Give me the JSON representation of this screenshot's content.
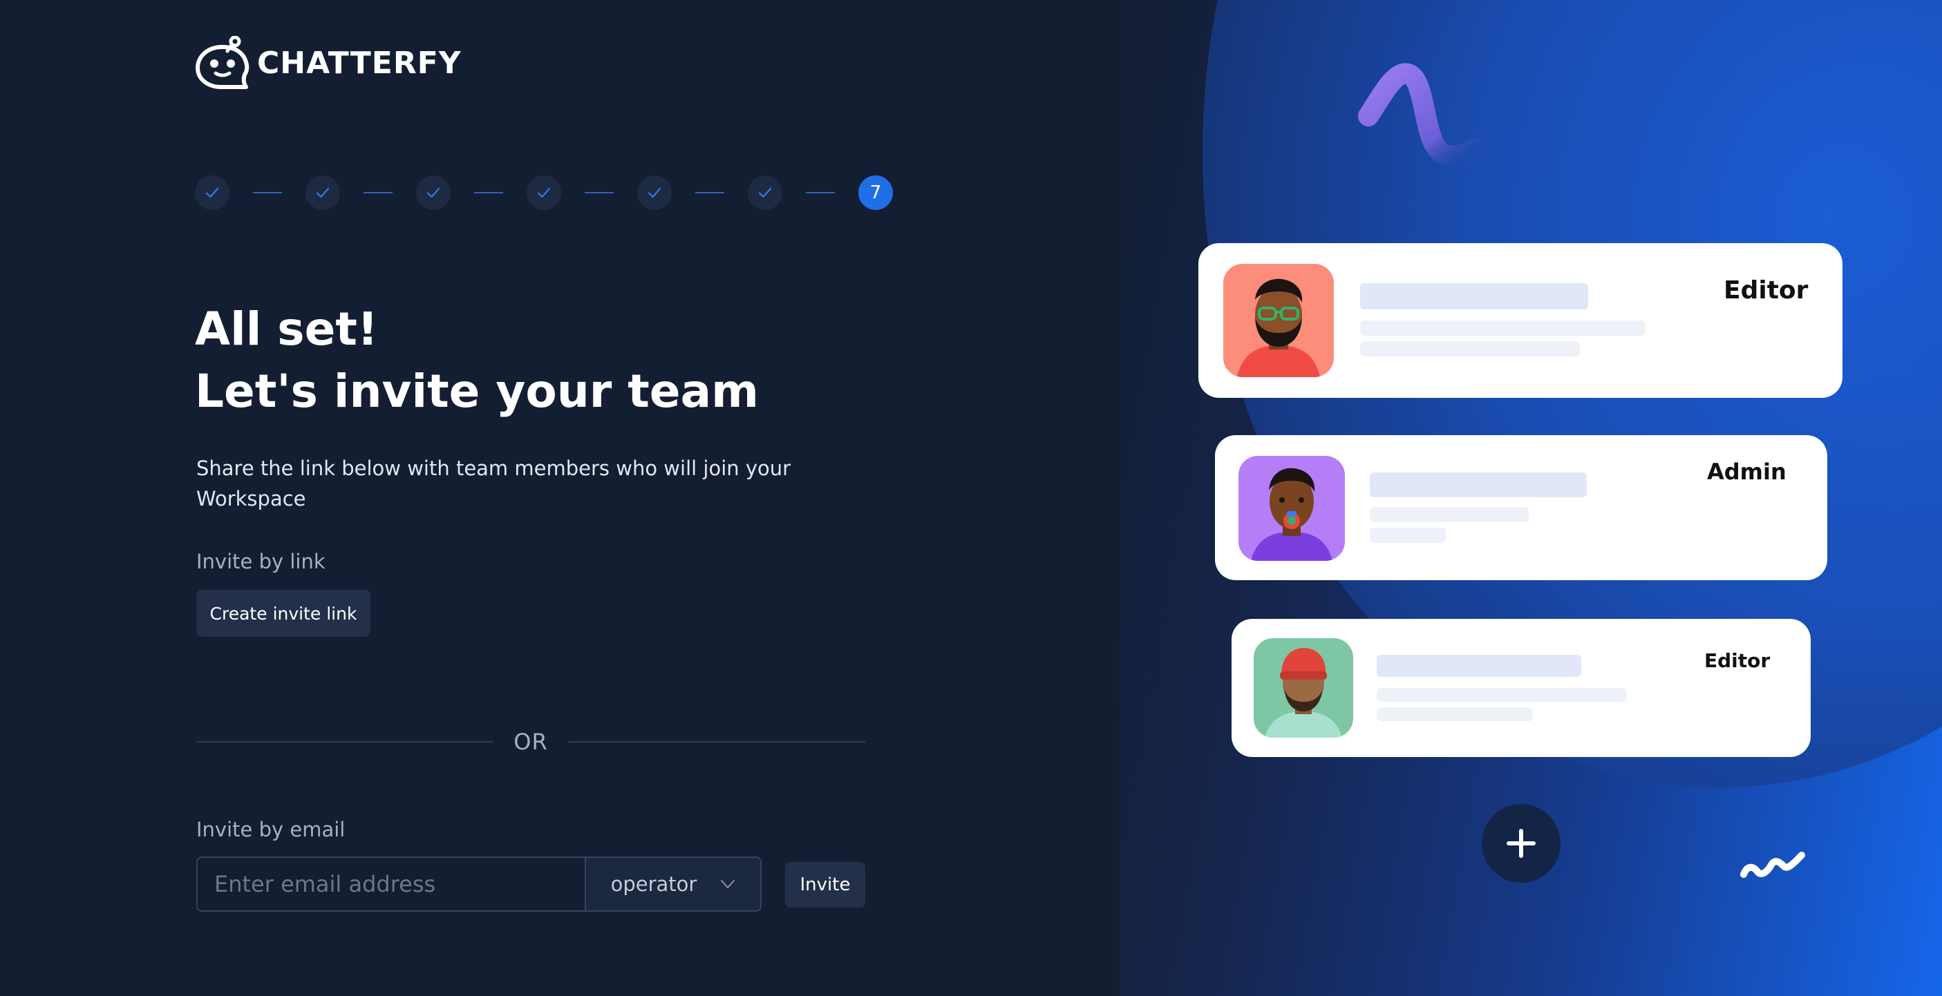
{
  "app": {
    "name": "CHATTERFY"
  },
  "stepper": {
    "completed_steps": 6,
    "current_step": "7"
  },
  "heading": {
    "line1": "All set!",
    "line2": "Let's invite your team"
  },
  "subtitle": "Share the link below with team members who will join your Workspace",
  "invite_link": {
    "label": "Invite by link",
    "button_label": "Create invite link"
  },
  "divider": {
    "label": "OR"
  },
  "invite_email": {
    "label": "Invite by email",
    "placeholder": "Enter email address",
    "value": "",
    "role_selected": "operator",
    "button_label": "Invite"
  },
  "illustration": {
    "cards": [
      {
        "role": "Editor",
        "avatar_bg": "#fb8d7a",
        "avatar_icon": "bearded-man-glasses-avatar"
      },
      {
        "role": "Admin",
        "avatar_bg": "#b57ef7",
        "avatar_icon": "man-with-pacifier-avatar"
      },
      {
        "role": "Editor",
        "avatar_bg": "#7fc6a4",
        "avatar_icon": "man-red-beanie-avatar"
      }
    ],
    "add_button_icon": "plus-icon"
  },
  "colors": {
    "background": "#141e33",
    "accent": "#1e6fe6",
    "panel_button": "#243049",
    "step_line": "#2f62b8"
  }
}
